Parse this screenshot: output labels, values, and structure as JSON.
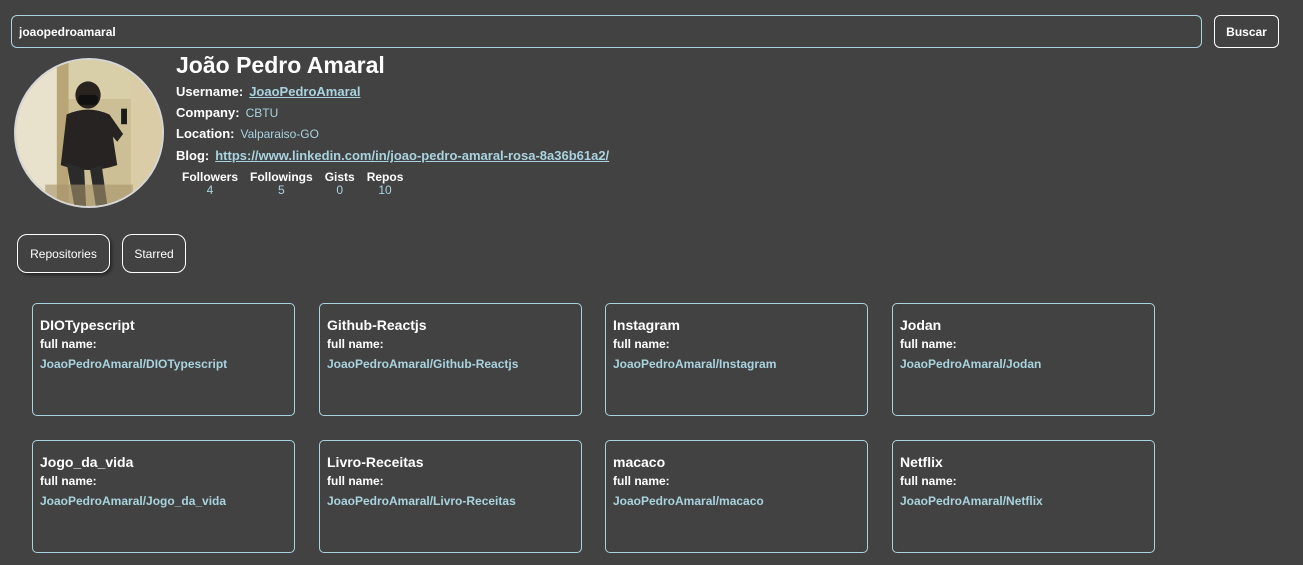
{
  "search": {
    "value": "joaopedroamaral",
    "button_label": "Buscar"
  },
  "profile": {
    "name": "João Pedro Amaral",
    "username_label": "Username:",
    "username": "JoaoPedroAmaral",
    "company_label": "Company:",
    "company": "CBTU",
    "location_label": "Location:",
    "location": "Valparaiso-GO",
    "blog_label": "Blog:",
    "blog": "https://www.linkedin.com/in/joao-pedro-amaral-rosa-8a36b61a2/",
    "stats": [
      {
        "label": "Followers",
        "value": "4"
      },
      {
        "label": "Followings",
        "value": "5"
      },
      {
        "label": "Gists",
        "value": "0"
      },
      {
        "label": "Repos",
        "value": "10"
      }
    ]
  },
  "tabs": [
    {
      "label": "Repositories",
      "active": true
    },
    {
      "label": "Starred",
      "active": false
    }
  ],
  "repos": [
    {
      "name": "DIOTypescript",
      "full_label": "full name:",
      "full_name": "JoaoPedroAmaral/DIOTypescript"
    },
    {
      "name": "Github-Reactjs",
      "full_label": "full name:",
      "full_name": "JoaoPedroAmaral/Github-Reactjs"
    },
    {
      "name": "Instagram",
      "full_label": "full name:",
      "full_name": "JoaoPedroAmaral/Instagram"
    },
    {
      "name": "Jodan",
      "full_label": "full name:",
      "full_name": "JoaoPedroAmaral/Jodan"
    },
    {
      "name": "Jogo_da_vida",
      "full_label": "full name:",
      "full_name": "JoaoPedroAmaral/Jogo_da_vida"
    },
    {
      "name": "Livro-Receitas",
      "full_label": "full name:",
      "full_name": "JoaoPedroAmaral/Livro-Receitas"
    },
    {
      "name": "macaco",
      "full_label": "full name:",
      "full_name": "JoaoPedroAmaral/macaco"
    },
    {
      "name": "Netflix",
      "full_label": "full name:",
      "full_name": "JoaoPedroAmaral/Netflix"
    }
  ],
  "colors": {
    "background": "#424242",
    "accent": "#a9d3df",
    "text": "#ffffff"
  }
}
